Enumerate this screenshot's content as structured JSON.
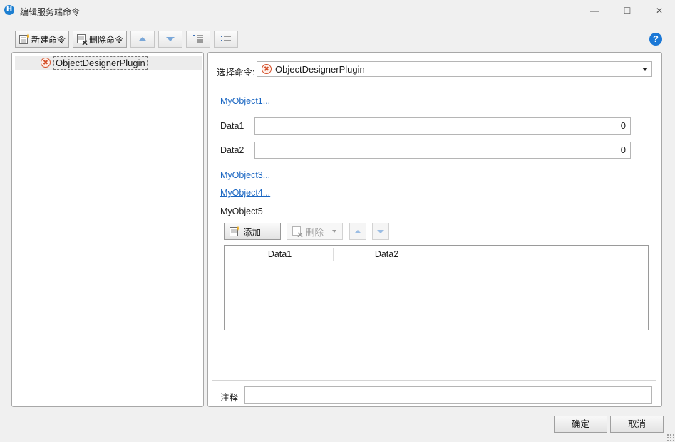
{
  "window": {
    "title": "编辑服务端命令",
    "app_icon_letter": "H",
    "minimize_glyph": "—",
    "maximize_glyph": "☐",
    "close_glyph": "✕"
  },
  "toolbar": {
    "new_command_label": "新建命令",
    "delete_command_label": "删除命令",
    "help_glyph": "?"
  },
  "tree": {
    "items": [
      {
        "label": "ObjectDesignerPlugin",
        "icon": "error-circle-icon",
        "selected": true
      }
    ]
  },
  "editor": {
    "select_command_label": "选择命令:",
    "selected_command": "ObjectDesignerPlugin",
    "links": [
      "MyObject1...",
      "MyObject3...",
      "MyObject4..."
    ],
    "fields": [
      {
        "label": "Data1",
        "value": "0"
      },
      {
        "label": "Data2",
        "value": "0"
      }
    ],
    "list_section_label": "MyObject5",
    "add_label": "添加",
    "delete_label": "删除",
    "grid_columns": [
      "Data1",
      "Data2"
    ],
    "note_label": "注释",
    "note_value": ""
  },
  "footer": {
    "ok_label": "确定",
    "cancel_label": "取消"
  },
  "colors": {
    "link": "#1a66c2",
    "error_icon": "#d4502a",
    "help": "#1b78d6",
    "arrow": "#7aa7d8"
  }
}
